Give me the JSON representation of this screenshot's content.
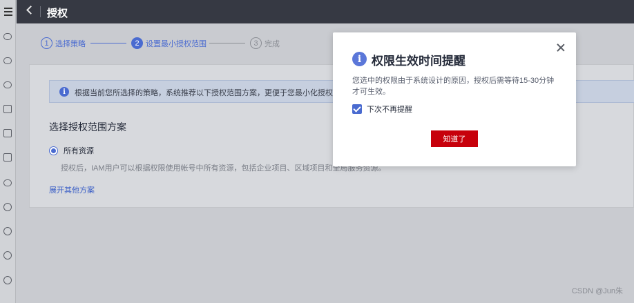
{
  "header": {
    "title": "授权"
  },
  "steps": [
    {
      "num": "1",
      "label": "选择策略"
    },
    {
      "num": "2",
      "label": "设置最小授权范围"
    },
    {
      "num": "3",
      "label": "完成"
    }
  ],
  "info_banner": {
    "text": "根据当前您所选择的策略，系统推荐以下授权范围方案，更便于您最小化授权，可"
  },
  "scope": {
    "section_title": "选择授权范围方案",
    "option_label": "所有资源",
    "option_desc": "授权后，IAM用户可以根据权限使用帐号中所有资源，包括企业项目、区域项目和全局服务资源。",
    "expand_link": "展开其他方案"
  },
  "modal": {
    "title": "权限生效时间提醒",
    "body": "您选中的权限由于系统设计的原因，授权后需等待15-30分钟才可生效。",
    "checkbox_label": "下次不再提醒",
    "checkbox_checked": true,
    "button_label": "知道了"
  },
  "watermark": "CSDN @Jun朱",
  "colors": {
    "accent": "#4a6bd0",
    "primary_button": "#c7000b",
    "topbar": "#363943"
  },
  "sidebar_icons": [
    "menu-icon",
    "cloud-icon",
    "cloud-more-icon",
    "cloud-list-icon",
    "wave-icon",
    "server-icon",
    "db-icon",
    "network-icon",
    "refresh-icon",
    "anchor-icon",
    "ip-icon",
    "cluster-icon"
  ]
}
